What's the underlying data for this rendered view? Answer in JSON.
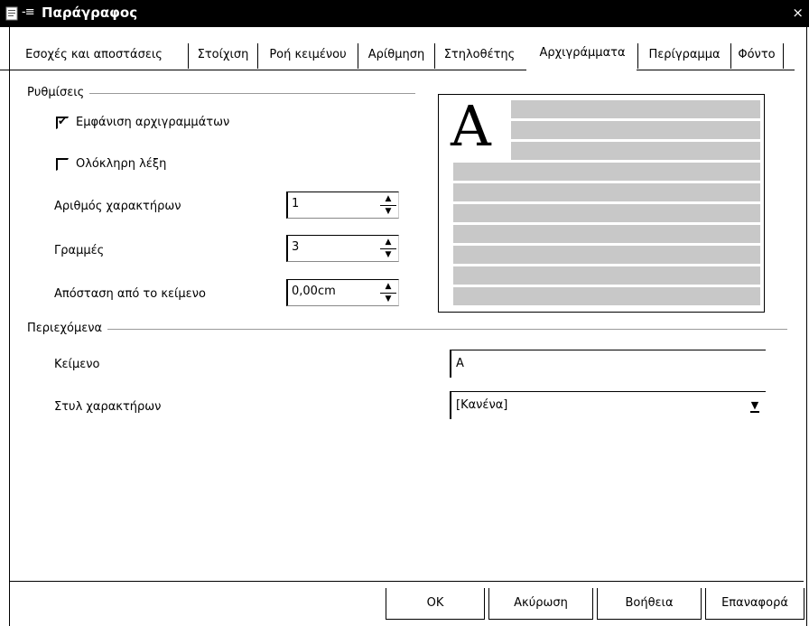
{
  "window": {
    "title": "Παράγραφος",
    "pin_glyph": "-≡",
    "close_glyph": "×"
  },
  "tabs": [
    {
      "label": "Εσοχές και αποστάσεις"
    },
    {
      "label": "Στοίχιση"
    },
    {
      "label": "Ροή κειμένου"
    },
    {
      "label": "Αρίθμηση"
    },
    {
      "label": "Στηλοθέτης"
    },
    {
      "label": "Αρχιγράμματα",
      "active": true
    },
    {
      "label": "Περίγραμμα"
    },
    {
      "label": "Φόντο"
    }
  ],
  "settings": {
    "group_label": "Ρυθμίσεις",
    "show_dropcaps": {
      "label": "Εμφάνιση αρχιγραμμάτων",
      "checked": true,
      "tick": "✔"
    },
    "whole_word": {
      "label": "Ολόκληρη λέξη",
      "checked": false
    },
    "num_chars": {
      "label": "Αριθμός χαρακτήρων",
      "value": "1"
    },
    "lines": {
      "label": "Γραμμές",
      "value": "3"
    },
    "distance": {
      "label": "Απόσταση από το κείμενο",
      "value": "0,00cm"
    }
  },
  "preview": {
    "letter": "A"
  },
  "contents": {
    "group_label": "Περιεχόμενα",
    "text": {
      "label": "Κείμενο",
      "value": "A"
    },
    "char_style": {
      "label": "Στυλ χαρακτήρων",
      "value": "[Κανένα]"
    }
  },
  "buttons": {
    "ok": "OK",
    "cancel": "Ακύρωση",
    "help": "Βοήθεια",
    "reset": "Επαναφορά"
  },
  "icons": {
    "spin_up": "▲",
    "spin_down": "▼",
    "dropdown": "▼"
  }
}
